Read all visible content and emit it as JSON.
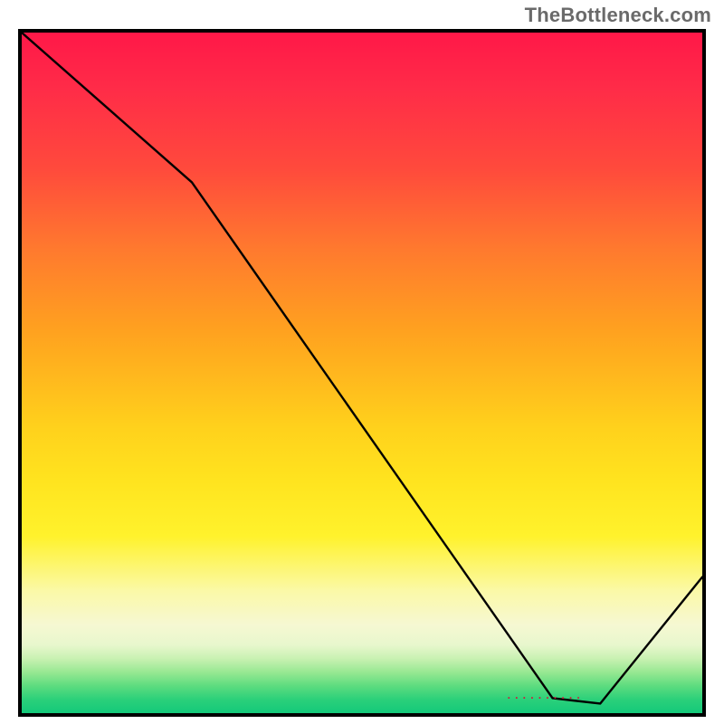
{
  "watermark": "TheBottleneck.com",
  "chart_data": {
    "type": "line",
    "title": "",
    "xlabel": "",
    "ylabel": "",
    "xlim": [
      0,
      100
    ],
    "ylim": [
      0,
      100
    ],
    "grid": false,
    "series": [
      {
        "name": "curve",
        "x": [
          0,
          25,
          78,
          85,
          100
        ],
        "values": [
          100,
          78,
          2.2,
          1.4,
          20
        ]
      }
    ],
    "gradient_stops": [
      {
        "pos": 0,
        "color": "#ff1848"
      },
      {
        "pos": 20,
        "color": "#ff4a3c"
      },
      {
        "pos": 44,
        "color": "#ffa21f"
      },
      {
        "pos": 66,
        "color": "#ffe41f"
      },
      {
        "pos": 82,
        "color": "#fbf9a7"
      },
      {
        "pos": 92,
        "color": "#c8f1b2"
      },
      {
        "pos": 100,
        "color": "#14c97a"
      }
    ],
    "minimum_marker": {
      "x": 82,
      "y": 1.8
    }
  }
}
